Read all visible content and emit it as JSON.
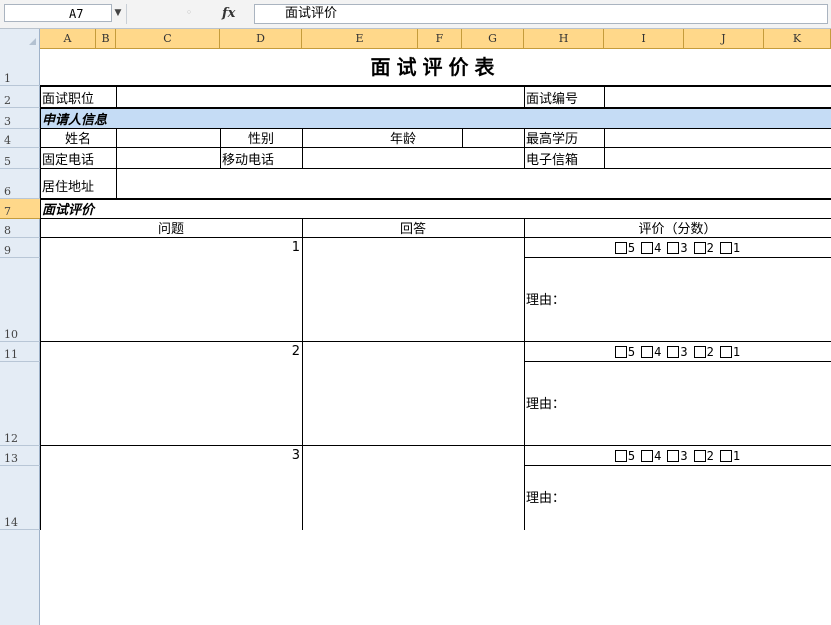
{
  "formula_bar": {
    "name_box": "A7",
    "fx_label": "fx",
    "cancel_symbol": "◦",
    "formula": "面试评价"
  },
  "column_headers": [
    "A",
    "B",
    "C",
    "D",
    "E",
    "F",
    "G",
    "H",
    "I",
    "J",
    "K"
  ],
  "row_headers": [
    "1",
    "2",
    "3",
    "4",
    "5",
    "6",
    "7",
    "8",
    "9",
    "10",
    "11",
    "12",
    "13",
    "14"
  ],
  "selected_row": "7",
  "colors": {
    "header_highlight": "#ffd88a",
    "section_fill": "#c5dcf5",
    "header_bg": "#e4ecf5"
  },
  "sheet": {
    "title": "面试评价表",
    "position_label": "面试职位",
    "number_label": "面试编号",
    "applicant_section": "申请人信息",
    "name_label": "姓名",
    "gender_label": "性别",
    "age_label": "年龄",
    "education_label": "最高学历",
    "phone_label": "固定电话",
    "mobile_label": "移动电话",
    "email_label": "电子信箱",
    "address_label": "居住地址",
    "evaluation_section": "面试评价",
    "question_header": "问题",
    "answer_header": "回答",
    "rating_header": "评价（分数）",
    "rating_options": [
      "5",
      "4",
      "3",
      "2",
      "1"
    ],
    "reason_label": "理由：",
    "questions": [
      {
        "number": "1"
      },
      {
        "number": "2"
      },
      {
        "number": "3"
      }
    ]
  }
}
